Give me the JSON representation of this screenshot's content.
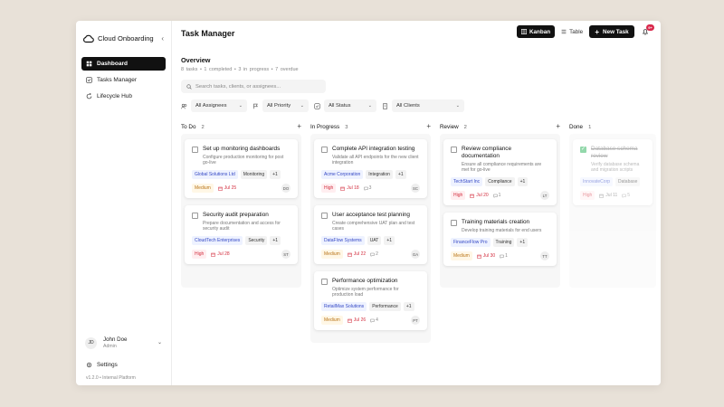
{
  "sidebar": {
    "brand": "Cloud Onboarding",
    "items": [
      {
        "label": "Dashboard"
      },
      {
        "label": "Tasks Manager"
      },
      {
        "label": "Lifecycle Hub"
      }
    ],
    "user": {
      "initials": "JD",
      "name": "John Doe",
      "role": "Admin"
    },
    "settings_label": "Settings",
    "version": "v1.2.0 • Internal Platform"
  },
  "header": {
    "title": "Task Manager",
    "view_kanban": "Kanban",
    "view_table": "Table",
    "new_task": "New Task",
    "notifications": "9+"
  },
  "overview": {
    "title": "Overview",
    "stats": "8 tasks  •  1 completed  •  3 in progress  •  7 overdue"
  },
  "search": {
    "placeholder": "Search tasks, clients, or assignees..."
  },
  "filters": {
    "assignees": "All Assignees",
    "priority": "All Priority",
    "status": "All Status",
    "clients": "All Clients"
  },
  "columns": [
    {
      "name": "To Do",
      "count": "2",
      "cards": [
        {
          "title": "Set up monitoring dashboards",
          "desc": "Configure production monitoring for post go-live",
          "client": "Global Solutions Ltd",
          "tag": "Monitoring",
          "more": "+1",
          "priority": "Medium",
          "date": "Jul 25",
          "comments": "",
          "assignee": "DO"
        },
        {
          "title": "Security audit preparation",
          "desc": "Prepare documentation and access for security audit",
          "client": "CloudTech Enterprises",
          "tag": "Security",
          "more": "+1",
          "priority": "High",
          "date": "Jul 28",
          "comments": "",
          "assignee": "ST"
        }
      ]
    },
    {
      "name": "In Progress",
      "count": "3",
      "cards": [
        {
          "title": "Complete API integration testing",
          "desc": "Validate all API endpoints for the new client integration",
          "client": "Acme Corporation",
          "tag": "Integration",
          "more": "+1",
          "priority": "High",
          "date": "Jul 18",
          "comments": "3",
          "assignee": "SC"
        },
        {
          "title": "User acceptance test planning",
          "desc": "Create comprehensive UAT plan and test cases",
          "client": "DataFlow Systems",
          "tag": "UAT",
          "more": "+1",
          "priority": "Medium",
          "date": "Jul 22",
          "comments": "2",
          "assignee": "GA"
        },
        {
          "title": "Performance optimization",
          "desc": "Optimize system performance for production load",
          "client": "RetailMax Solutions",
          "tag": "Performance",
          "more": "+1",
          "priority": "Medium",
          "date": "Jul 26",
          "comments": "4",
          "assignee": "PT"
        }
      ]
    },
    {
      "name": "Review",
      "count": "2",
      "cards": [
        {
          "title": "Review compliance documentation",
          "desc": "Ensure all compliance requirements are met for go-live",
          "client": "TechStart Inc",
          "tag": "Compliance",
          "more": "+1",
          "priority": "High",
          "date": "Jul 20",
          "comments": "1",
          "assignee": "LT"
        },
        {
          "title": "Training materials creation",
          "desc": "Develop training materials for end users",
          "client": "FinanceFlow Pro",
          "tag": "Training",
          "more": "+1",
          "priority": "Medium",
          "date": "Jul 30",
          "comments": "1",
          "assignee": "TT"
        }
      ]
    },
    {
      "name": "Done",
      "count": "1",
      "cards": [
        {
          "title": "Database schema review",
          "desc": "Verify database schema and migration scripts",
          "client": "InnovateCorp",
          "tag": "Database",
          "more": "",
          "priority": "High",
          "date": "Jul 11",
          "comments": "5",
          "assignee": ""
        }
      ]
    }
  ]
}
